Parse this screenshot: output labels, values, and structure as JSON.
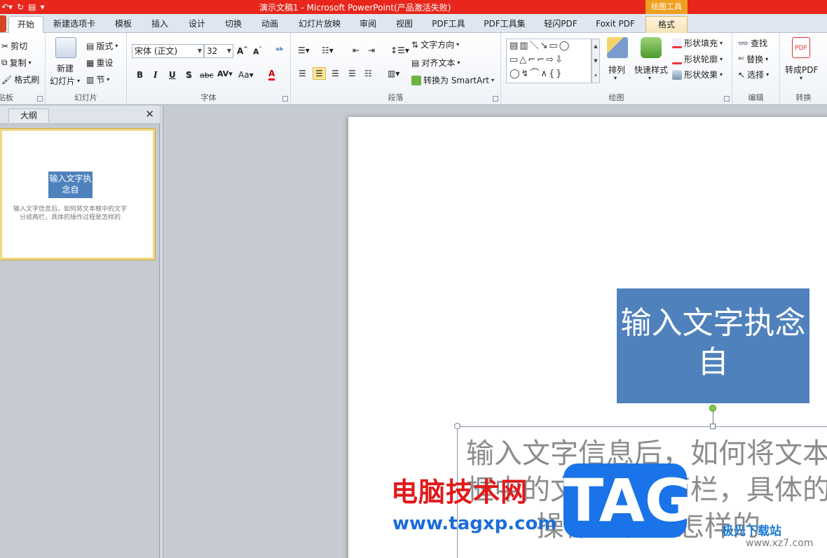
{
  "app": {
    "title": "演示文稿1 - Microsoft PowerPoint(产品激活失败)",
    "context_group": "绘图工具"
  },
  "tabs": [
    {
      "label": "开始",
      "active": true
    },
    {
      "label": "新建选项卡"
    },
    {
      "label": "模板"
    },
    {
      "label": "插入"
    },
    {
      "label": "设计"
    },
    {
      "label": "切换"
    },
    {
      "label": "动画"
    },
    {
      "label": "幻灯片放映"
    },
    {
      "label": "审阅"
    },
    {
      "label": "视图"
    },
    {
      "label": "PDF工具"
    },
    {
      "label": "PDF工具集"
    },
    {
      "label": "轻闪PDF"
    },
    {
      "label": "Foxit PDF"
    },
    {
      "label": "格式"
    }
  ],
  "ribbon": {
    "clipboard": {
      "label": "剪贴板",
      "cut": "剪切",
      "copy": "复制",
      "painter": "格式刷"
    },
    "slides": {
      "label": "幻灯片",
      "new_slide_1": "新建",
      "new_slide_2": "幻灯片",
      "layout": "版式",
      "reset": "重设",
      "section": "节"
    },
    "font": {
      "label": "字体",
      "font_name": "宋体 (正文)",
      "font_size": "32"
    },
    "paragraph": {
      "label": "段落",
      "text_direction": "文字方向",
      "align_text": "对齐文本",
      "smartart": "转换为 SmartArt"
    },
    "drawing": {
      "label": "绘图",
      "arrange": "排列",
      "quick_styles": "快速样式",
      "shape_fill": "形状填充",
      "shape_outline": "形状轮廓",
      "shape_effects": "形状效果"
    },
    "editing": {
      "label": "编辑",
      "find": "查找",
      "replace": "替换",
      "select": "选择"
    },
    "convert": {
      "label": "转换",
      "to_pdf": "转成PDF"
    }
  },
  "left_pane": {
    "outline_tab": "大纲",
    "thumb_title": "输入文字执念自",
    "thumb_body": "输入文字信息后，如何将文本框中的文字分成两栏，具体的操作过程是怎样的"
  },
  "slide": {
    "title": "输入文字执念自",
    "body": "输入文字信息后，如何将文本框中的文字分成两栏，具体的操作过程是怎样的"
  },
  "watermark": {
    "cn": "电脑技术网",
    "url": "www.tagxp.com",
    "tag": "TAG",
    "site": "极光下载站",
    "site_url": "www.xz7.com"
  }
}
